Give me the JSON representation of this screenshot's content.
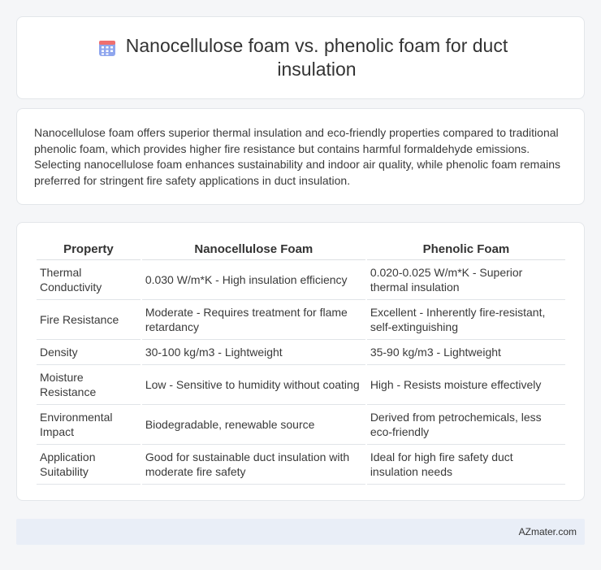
{
  "header": {
    "title": "Nanocellulose foam vs. phenolic foam for duct insulation",
    "icon": "calendar-icon",
    "icon_colors": {
      "body": "#8fa6ee",
      "top": "#ef6f6f",
      "grid": "#ffffff"
    }
  },
  "summary": {
    "text": "Nanocellulose foam offers superior thermal insulation and eco-friendly properties compared to traditional phenolic foam, which provides higher fire resistance but contains harmful formaldehyde emissions. Selecting nanocellulose foam enhances sustainability and indoor air quality, while phenolic foam remains preferred for stringent fire safety applications in duct insulation."
  },
  "table": {
    "headers": [
      "Property",
      "Nanocellulose Foam",
      "Phenolic Foam"
    ],
    "rows": [
      [
        "Thermal Conductivity",
        "0.030 W/m*K - High insulation efficiency",
        "0.020-0.025 W/m*K - Superior thermal insulation"
      ],
      [
        "Fire Resistance",
        "Moderate - Requires treatment for flame retardancy",
        "Excellent - Inherently fire-resistant, self-extinguishing"
      ],
      [
        "Density",
        "30-100 kg/m3 - Lightweight",
        "35-90 kg/m3 - Lightweight"
      ],
      [
        "Moisture Resistance",
        "Low - Sensitive to humidity without coating",
        "High - Resists moisture effectively"
      ],
      [
        "Environmental Impact",
        "Biodegradable, renewable source",
        "Derived from petrochemicals, less eco-friendly"
      ],
      [
        "Application Suitability",
        "Good for sustainable duct insulation with moderate fire safety",
        "Ideal for high fire safety duct insulation needs"
      ]
    ]
  },
  "footer": {
    "text": "AZmater.com"
  }
}
